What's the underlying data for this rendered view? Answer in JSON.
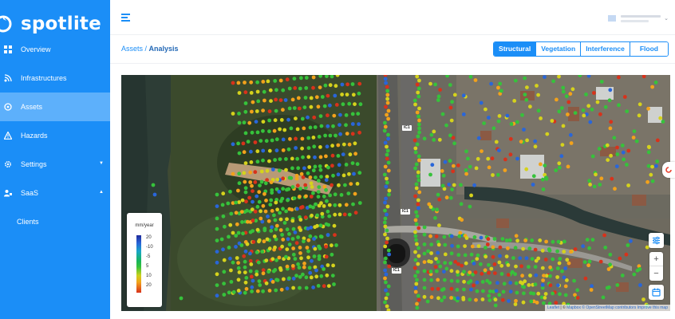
{
  "brand": {
    "name": "spotlite"
  },
  "sidebar": {
    "items": [
      {
        "label": "Overview",
        "icon": "grid-icon"
      },
      {
        "label": "Infrastructures",
        "icon": "signal-icon"
      },
      {
        "label": "Assets",
        "icon": "asset-icon",
        "active": true
      },
      {
        "label": "Hazards",
        "icon": "warning-icon"
      },
      {
        "label": "Settings",
        "icon": "gear-icon",
        "caret": "▼"
      },
      {
        "label": "SaaS",
        "icon": "people-icon",
        "caret": "▲"
      }
    ],
    "sub_items": [
      {
        "label": "Clients"
      }
    ]
  },
  "breadcrumb": {
    "parent": "Assets",
    "separator": " / ",
    "current": "Analysis"
  },
  "tabs": [
    {
      "label": "Structural",
      "active": true
    },
    {
      "label": "Vegetation"
    },
    {
      "label": "Interference"
    },
    {
      "label": "Flood"
    }
  ],
  "map": {
    "road_labels": [
      "IC1",
      "IC1",
      "IC1"
    ],
    "legend": {
      "title": "mm/year",
      "ticks": [
        "20",
        "-10",
        "-5",
        "5",
        "10",
        "20"
      ]
    },
    "attribution": {
      "leaflet": "Leaflet",
      "sep": " | © ",
      "mapbox": "Mapbox",
      "osm": "© OpenStreetMap contributors",
      "improve": "Improve this map"
    }
  },
  "colors": {
    "accent": "#1b8ef7",
    "sidebar_active": "#5db0fb",
    "point_green": "#36c23b",
    "point_yellow": "#d5d21c",
    "point_orange": "#f2a21b",
    "point_red": "#d8321b",
    "point_blue": "#2966d9"
  }
}
